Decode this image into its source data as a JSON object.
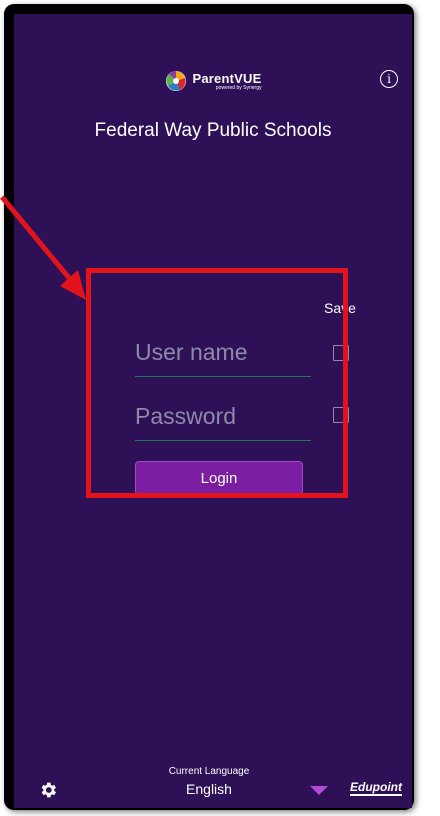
{
  "header": {
    "logo_name": "ParentVUE",
    "logo_sub": "powered by Synergy",
    "info_icon": "info-icon"
  },
  "district_name": "Federal Way Public Schools",
  "login_form": {
    "save_label": "Save",
    "username_placeholder": "User name",
    "password_placeholder": "Password",
    "login_label": "Login"
  },
  "footer": {
    "settings_icon": "gear-icon",
    "language_caption": "Current Language",
    "language_value": "English",
    "dropdown_icon": "triangle-down-icon",
    "brand": "Edupoint"
  },
  "colors": {
    "background": "#2e1056",
    "accent": "#7b1ea2",
    "annotation": "#e3131b",
    "underline": "#1f7a4a"
  }
}
